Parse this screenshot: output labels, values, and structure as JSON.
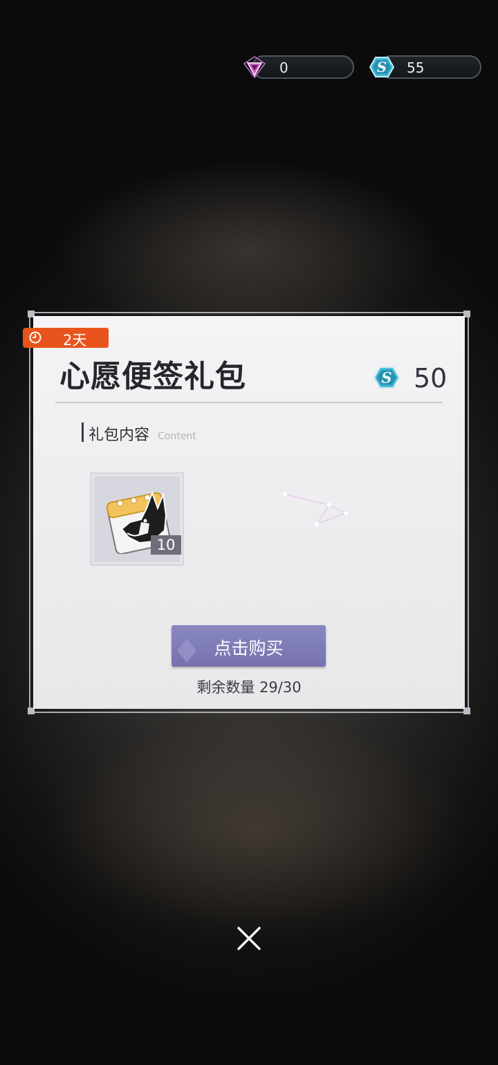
{
  "currencies": {
    "gem": {
      "value": "0",
      "icon": "pink-triangle-gem-icon",
      "color": "#e05bd6"
    },
    "coin": {
      "value": "55",
      "icon": "blue-s-coin-icon",
      "color": "#5fd0e6"
    }
  },
  "gift": {
    "timer": "2天",
    "title": "心愿便签礼包",
    "price": "50",
    "price_icon": "blue-s-coin-icon",
    "section_title": "礼包内容",
    "section_subtitle": "Content",
    "items": [
      {
        "name": "dog-note-item-icon",
        "count": "10"
      }
    ],
    "buy_label": "点击购买",
    "remaining_label": "剩余数量 29/30"
  },
  "colors": {
    "timer_badge": "#e8541c",
    "buy_button": "#7c79b6"
  }
}
